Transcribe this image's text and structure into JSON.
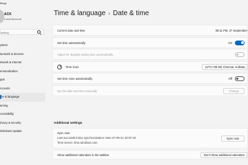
{
  "window": {
    "title": "ttings"
  },
  "profile": {
    "name": "ACK",
    "subtitle": "Local Account"
  },
  "search": {
    "placeholder": "setting"
  },
  "sidebar": {
    "items": [
      {
        "label": "ystem"
      },
      {
        "label": "luetooth & devices"
      },
      {
        "label": "etwork & internet"
      },
      {
        "label": "ersonalization"
      },
      {
        "label": "pps"
      },
      {
        "label": "ccounts"
      },
      {
        "label": "me & language"
      },
      {
        "label": "aming"
      },
      {
        "label": "ccessibility"
      },
      {
        "label": "rivacy & security"
      },
      {
        "label": "Windows Update"
      }
    ]
  },
  "header": {
    "section": "Time & language",
    "separator": "›",
    "page": "Date & time"
  },
  "rows": {
    "current": {
      "label": "Current date and time",
      "value": "08:11 PM, 27 September"
    },
    "set_time_auto": {
      "label": "Set time automatically",
      "state": "On"
    },
    "dst": {
      "label": "Adjust for daylight saving time automatically",
      "state": "Off"
    },
    "timezone": {
      "label": "Time zone",
      "value": "(UTC+05:30) Chennai, Kolkata, Mumbai, Nev"
    },
    "set_tz_auto": {
      "label": "Set time zone automatically",
      "state": "Off"
    },
    "manual": {
      "label": "Set the date and time manually",
      "button": "Change"
    }
  },
  "additional": {
    "title": "Additional settings",
    "sync": {
      "title": "Sync now",
      "last": "Last successful time synchronization: Mon-27-09-21 20:07:26",
      "server": "Time server: time.windows.com",
      "button": "Sync now"
    },
    "calendars": {
      "label": "Show additional calendars in the taskbar",
      "value": "Don't show additional calendars"
    }
  },
  "colors": {
    "accent": "#0067c0",
    "background": "#f3f3f3",
    "card": "#fbfbfb"
  }
}
